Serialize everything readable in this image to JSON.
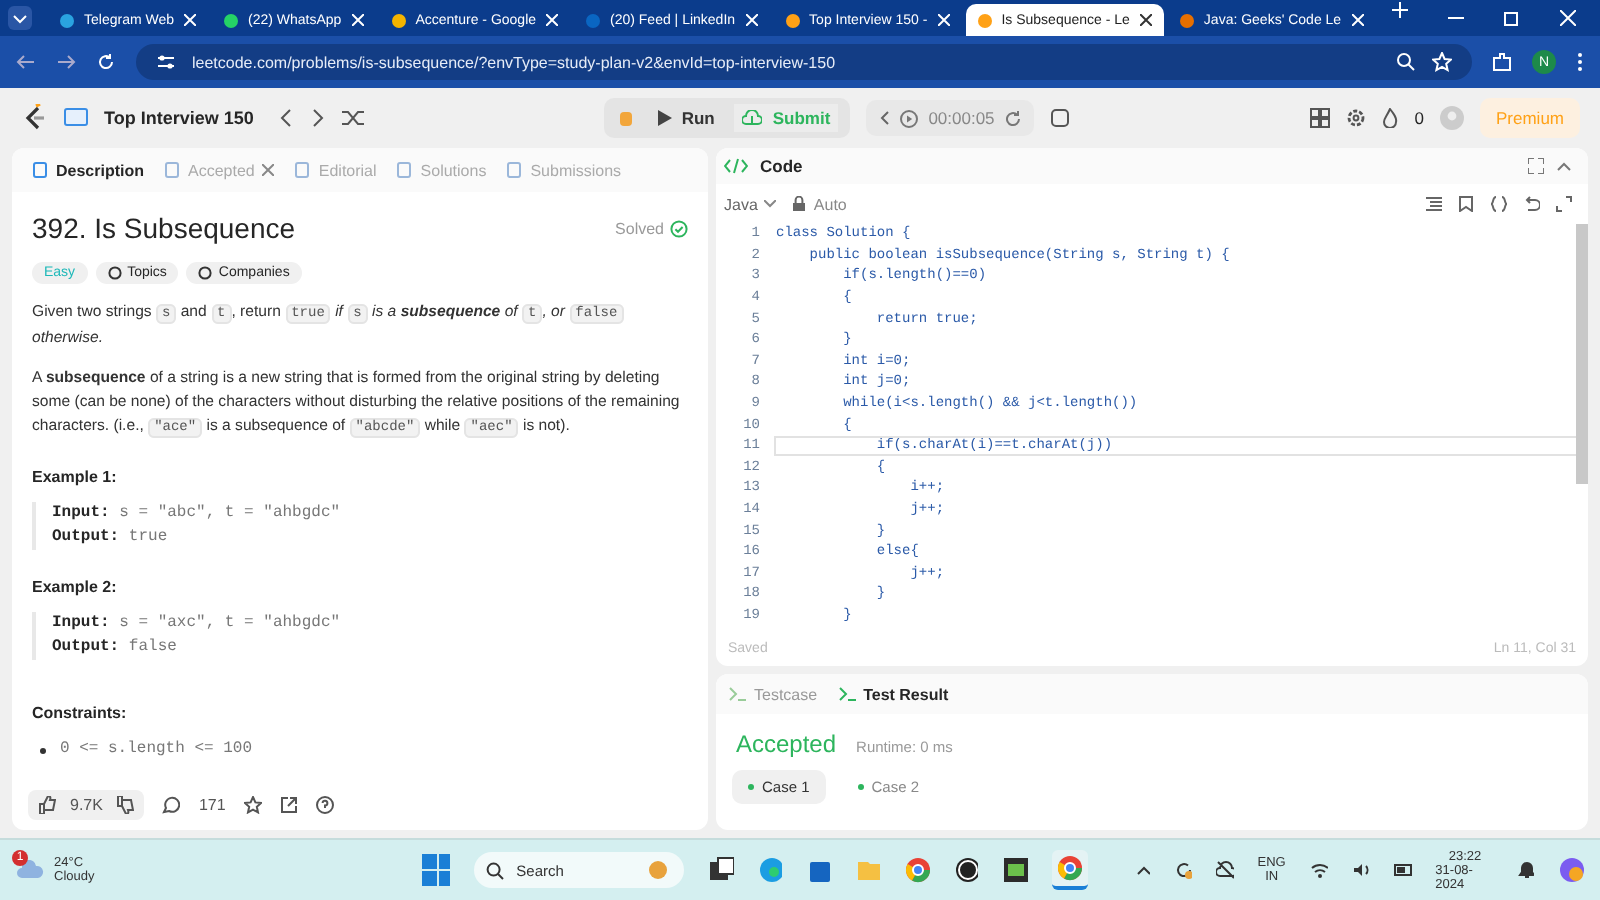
{
  "browser": {
    "tabs": [
      {
        "label": "Telegram Web",
        "selected": false
      },
      {
        "label": "(22) WhatsApp",
        "selected": false
      },
      {
        "label": "Accenture - Google",
        "selected": false
      },
      {
        "label": "(20) Feed | LinkedIn",
        "selected": false
      },
      {
        "label": "Top Interview 150 -",
        "selected": false
      },
      {
        "label": "Is Subsequence - Le",
        "selected": true
      },
      {
        "label": "Java: Geeks' Code Le",
        "selected": false
      }
    ],
    "url": "leetcode.com/problems/is-subsequence/?envType=study-plan-v2&envId=top-interview-150",
    "profile": "N"
  },
  "toolbar": {
    "list_title": "Top Interview 150",
    "run": "Run",
    "submit": "Submit",
    "timer": "00:00:05",
    "streak": "0",
    "premium": "Premium"
  },
  "problem": {
    "tabs": [
      {
        "label": "Description",
        "selected": true,
        "closable": false
      },
      {
        "label": "Accepted",
        "selected": false,
        "closable": true
      },
      {
        "label": "Editorial",
        "selected": false,
        "closable": false
      },
      {
        "label": "Solutions",
        "selected": false,
        "closable": false
      },
      {
        "label": "Submissions",
        "selected": false,
        "closable": false
      }
    ],
    "title": "392. Is Subsequence",
    "status": "Solved",
    "difficulty": "Easy",
    "tags": [
      "Topics",
      "Companies"
    ],
    "paragraphs": [
      [
        {
          "kind": "text",
          "text": "Given two strings "
        },
        {
          "kind": "code",
          "text": "s"
        },
        {
          "kind": "text",
          "text": " and "
        },
        {
          "kind": "code",
          "text": "t"
        },
        {
          "kind": "text",
          "text": ", return "
        },
        {
          "kind": "code",
          "text": "true"
        },
        {
          "kind": "italic",
          "text": " if "
        },
        {
          "kind": "code",
          "text": "s"
        },
        {
          "kind": "italic",
          "text": " is a "
        },
        {
          "kind": "bolditalic",
          "text": "subsequence"
        },
        {
          "kind": "italic",
          "text": " of "
        },
        {
          "kind": "code",
          "text": "t"
        },
        {
          "kind": "italic",
          "text": ", or "
        },
        {
          "kind": "code",
          "text": "false"
        },
        {
          "kind": "italic",
          "text": " otherwise."
        }
      ],
      [
        {
          "kind": "text",
          "text": "A "
        },
        {
          "kind": "bold",
          "text": "subsequence"
        },
        {
          "kind": "text",
          "text": " of a string is a new string that is formed from the original string by deleting some (can be none) of the characters without disturbing the relative positions of the remaining characters. (i.e., "
        },
        {
          "kind": "code",
          "text": "\"ace\""
        },
        {
          "kind": "text",
          "text": " is a subsequence of "
        },
        {
          "kind": "code",
          "text": "\"abcde\""
        },
        {
          "kind": "text",
          "text": " while "
        },
        {
          "kind": "code",
          "text": "\"aec\""
        },
        {
          "kind": "text",
          "text": " is not)."
        }
      ]
    ],
    "examples": [
      {
        "heading": "Example 1:",
        "input_label": "Input:",
        "input": "s = \"abc\", t = \"ahbgdc\"",
        "output_label": "Output:",
        "output": "true"
      },
      {
        "heading": "Example 2:",
        "input_label": "Input:",
        "input": "s = \"axc\", t = \"ahbgdc\"",
        "output_label": "Output:",
        "output": "false"
      }
    ],
    "constraints_heading": "Constraints:",
    "constraints": [
      "0 <= s.length <= 100"
    ],
    "likes": "9.7K",
    "comments": "171"
  },
  "editor": {
    "title": "Code",
    "language": "Java",
    "mode": "Auto",
    "lines": [
      {
        "no": "1",
        "code": "class Solution {",
        "current": false
      },
      {
        "no": "2",
        "code": "    public boolean isSubsequence(String s, String t) {",
        "current": false
      },
      {
        "no": "3",
        "code": "        if(s.length()==0)",
        "current": false
      },
      {
        "no": "4",
        "code": "        {",
        "current": false
      },
      {
        "no": "5",
        "code": "            return true;",
        "current": false
      },
      {
        "no": "6",
        "code": "        }",
        "current": false
      },
      {
        "no": "7",
        "code": "        int i=0;",
        "current": false
      },
      {
        "no": "8",
        "code": "        int j=0;",
        "current": false
      },
      {
        "no": "9",
        "code": "        while(i<s.length() && j<t.length())",
        "current": false
      },
      {
        "no": "10",
        "code": "        {",
        "current": false
      },
      {
        "no": "11",
        "code": "            if(s.charAt(i)==t.charAt(j))",
        "current": true
      },
      {
        "no": "12",
        "code": "            {",
        "current": false
      },
      {
        "no": "13",
        "code": "                i++;",
        "current": false
      },
      {
        "no": "14",
        "code": "                j++;",
        "current": false
      },
      {
        "no": "15",
        "code": "            }",
        "current": false
      },
      {
        "no": "16",
        "code": "            else{",
        "current": false
      },
      {
        "no": "17",
        "code": "                j++;",
        "current": false
      },
      {
        "no": "18",
        "code": "            }",
        "current": false
      },
      {
        "no": "19",
        "code": "        }",
        "current": false
      }
    ],
    "saved": "Saved",
    "cursor": "Ln 11, Col 31"
  },
  "results": {
    "tabs": [
      {
        "label": "Testcase",
        "selected": false
      },
      {
        "label": "Test Result",
        "selected": true
      }
    ],
    "verdict": "Accepted",
    "runtime": "Runtime: 0 ms",
    "cases": [
      {
        "label": "Case 1",
        "selected": true
      },
      {
        "label": "Case 2",
        "selected": false
      }
    ]
  },
  "taskbar": {
    "temperature": "24°C",
    "weather": "Cloudy",
    "weather_badge": "1",
    "search": "Search",
    "language": "ENG",
    "region": "IN",
    "time": "23:22",
    "date": "31-08-2024"
  }
}
